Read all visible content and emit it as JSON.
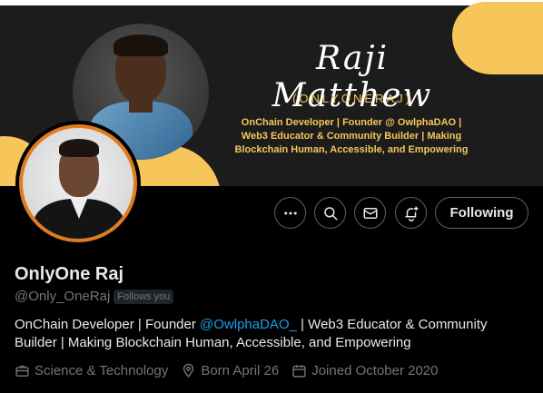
{
  "banner": {
    "name_script": "Raji Matthew",
    "handle_caps": "(ONLYONERAJ)",
    "tagline": "OnChain Developer | Founder @ OwlphaDAO | Web3 Educator & Community Builder | Making Blockchain Human, Accessible, and Empowering",
    "accent_color": "#f7c65a"
  },
  "avatar": {
    "ring_color": "#e07b1f"
  },
  "actions": {
    "more_icon": "more-horizontal-icon",
    "search_icon": "search-icon",
    "message_icon": "envelope-icon",
    "notify_icon": "bell-plus-icon",
    "follow_label": "Following"
  },
  "profile": {
    "display_name": "OnlyOne Raj",
    "username": "@Only_OneRaj",
    "follows_you": "Follows you",
    "bio_before": "OnChain Developer | Founder ",
    "bio_mention": "@OwlphaDAO_",
    "bio_after": " | Web3 Educator & Community Builder | Making Blockchain Human, Accessible, and Empowering",
    "mention_color": "#1d9bf0"
  },
  "meta": {
    "category": "Science & Technology",
    "born": "Born April 26",
    "joined": "Joined October 2020"
  }
}
